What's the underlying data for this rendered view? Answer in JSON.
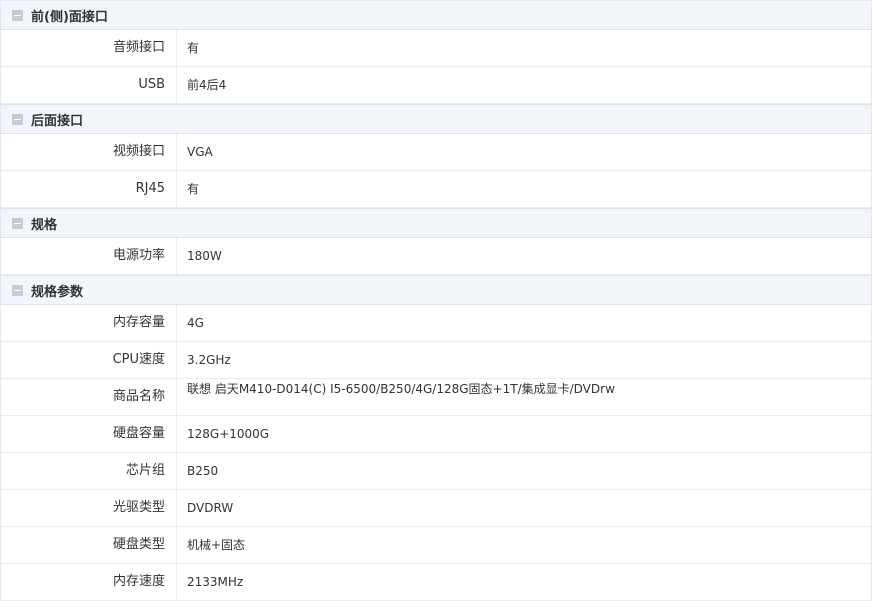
{
  "sections": [
    {
      "title": "前(侧)面接口",
      "rows": [
        {
          "label": "音频接口",
          "value": "有"
        },
        {
          "label": "USB",
          "value": "前4后4"
        }
      ]
    },
    {
      "title": "后面接口",
      "rows": [
        {
          "label": "视频接口",
          "value": "VGA"
        },
        {
          "label": "RJ45",
          "value": "有"
        }
      ]
    },
    {
      "title": "规格",
      "rows": [
        {
          "label": "电源功率",
          "value": "180W"
        }
      ]
    },
    {
      "title": "规格参数",
      "rows": [
        {
          "label": "内存容量",
          "value": "4G"
        },
        {
          "label": "CPU速度",
          "value": "3.2GHz"
        },
        {
          "label": "商品名称",
          "value": "联想 启天M410-D014(C) I5-6500/B250/4G/128G固态+1T/集成显卡/DVDrw"
        },
        {
          "label": "硬盘容量",
          "value": "128G+1000G"
        },
        {
          "label": "芯片组",
          "value": "B250"
        },
        {
          "label": "光驱类型",
          "value": "DVDRW"
        },
        {
          "label": "硬盘类型",
          "value": "机械+固态"
        },
        {
          "label": "内存速度",
          "value": "2133MHz"
        }
      ]
    }
  ]
}
